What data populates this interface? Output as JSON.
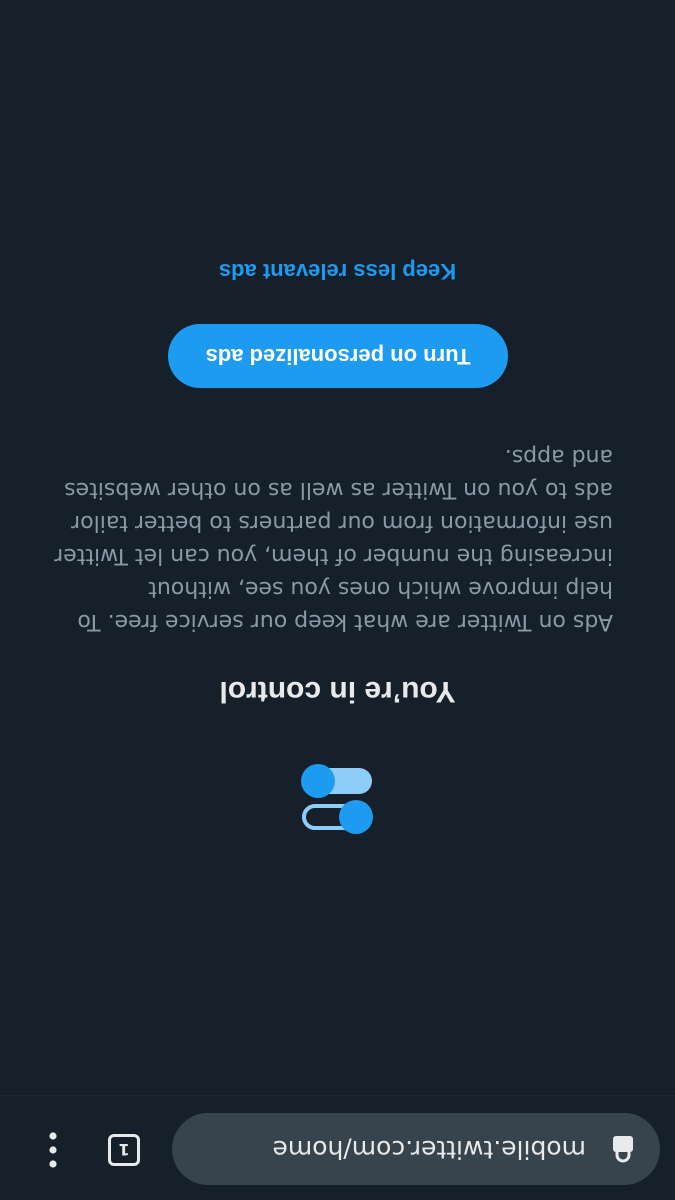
{
  "browser": {
    "url": "mobile.twitter.com/home",
    "tab_count": "1",
    "lock_icon": "lock-icon",
    "menu_icon": "three-dots-vertical-icon"
  },
  "ads_prompt": {
    "icon": "toggle-switches-icon",
    "title": "You’re in control",
    "body": "Ads on Twitter are what keep our service free. To help improve which ones you see, without increasing the number of them, you can let Twitter use information from our partners to better tailor ads to you on Twitter as well as on other websites and apps.",
    "primary_button": "Turn on personalized ads",
    "secondary_link": "Keep less relevant ads"
  },
  "colors": {
    "background": "#15202b",
    "accent": "#1d9bf0",
    "url_pill": "#38444d",
    "text_primary": "#e7e9ea",
    "text_secondary": "#8b98a5"
  }
}
